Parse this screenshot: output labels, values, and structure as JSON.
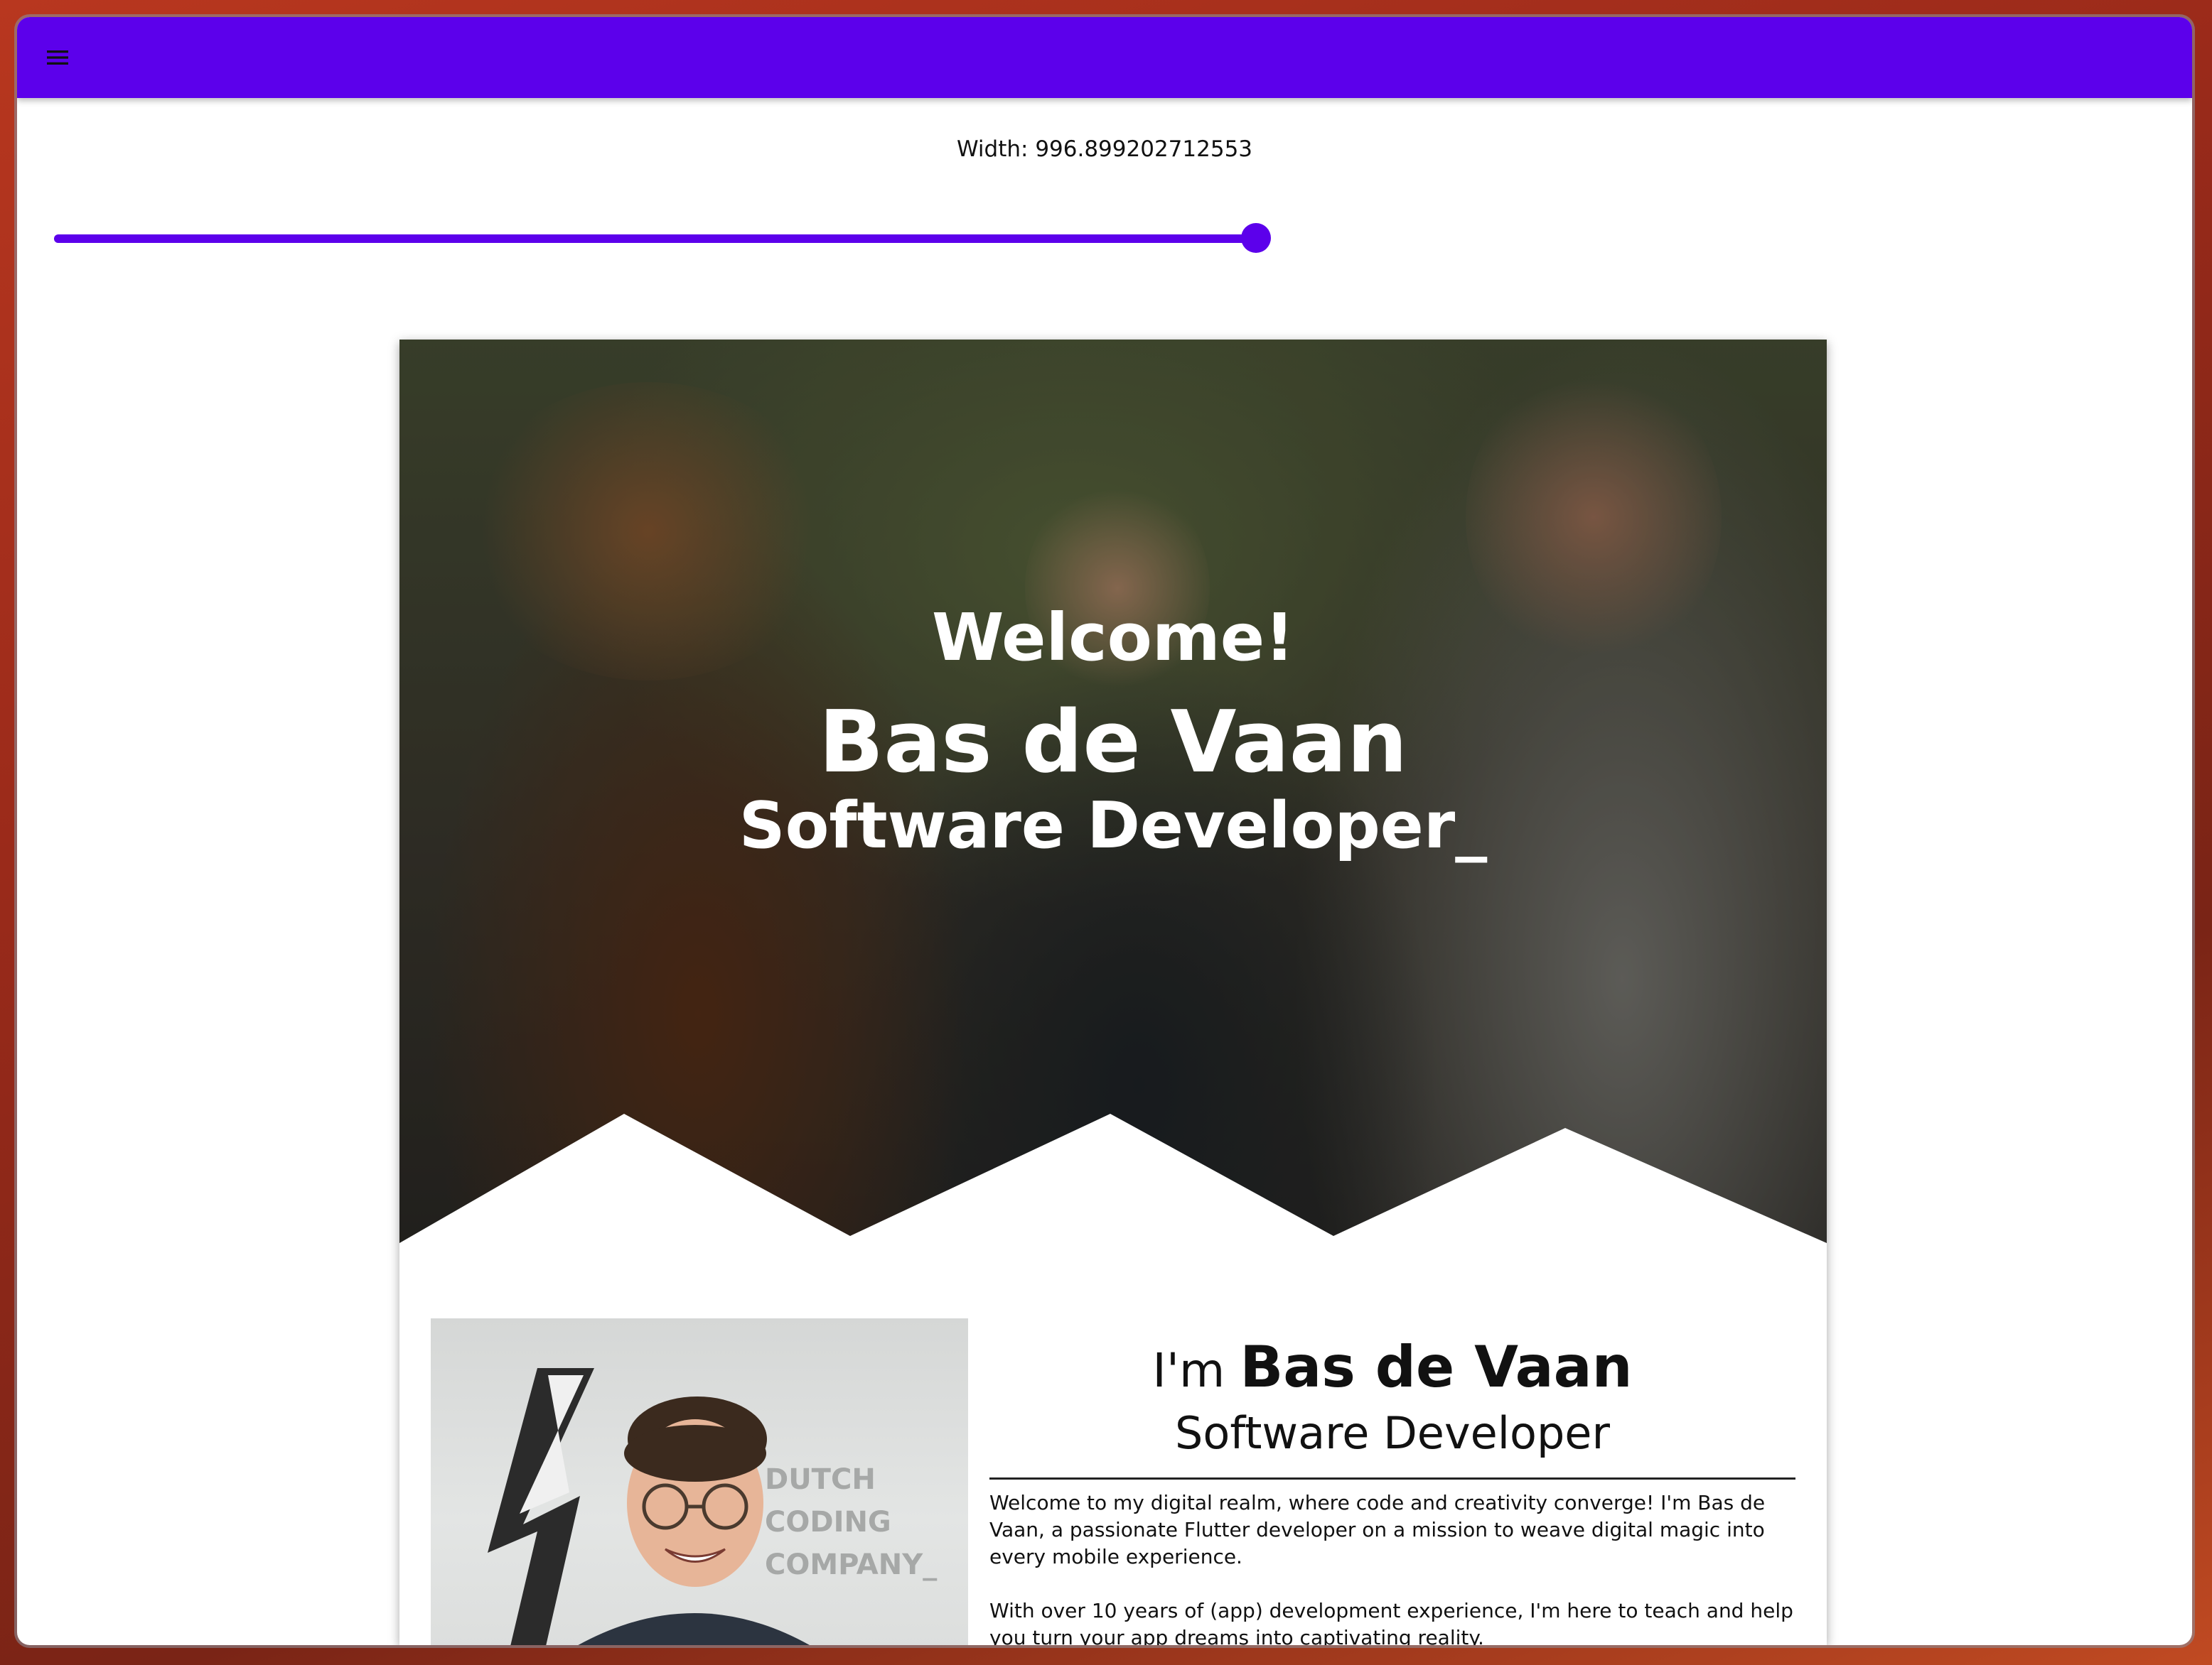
{
  "appbar": {
    "color": "#5c00eb",
    "menu_icon": "menu-icon"
  },
  "width_control": {
    "label": "Width: 996.899202712553",
    "slider_fraction": 0.988
  },
  "hero": {
    "greeting": "Welcome!",
    "name": "Bas de Vaan",
    "role": "Software Developer_"
  },
  "about": {
    "im_prefix": "I'm ",
    "name": "Bas de Vaan",
    "role": "Software Developer",
    "paragraphs": [
      "Welcome to my digital realm, where code and creativity converge! I'm Bas de Vaan, a passionate Flutter developer on a mission to weave digital magic into every mobile experience.",
      "With over 10 years of (app) development experience, I'm here to teach and help you turn your app dreams into captivating reality."
    ],
    "photo_sign_lines": [
      "DUTCH",
      "CODING",
      "COMPANY_"
    ]
  }
}
